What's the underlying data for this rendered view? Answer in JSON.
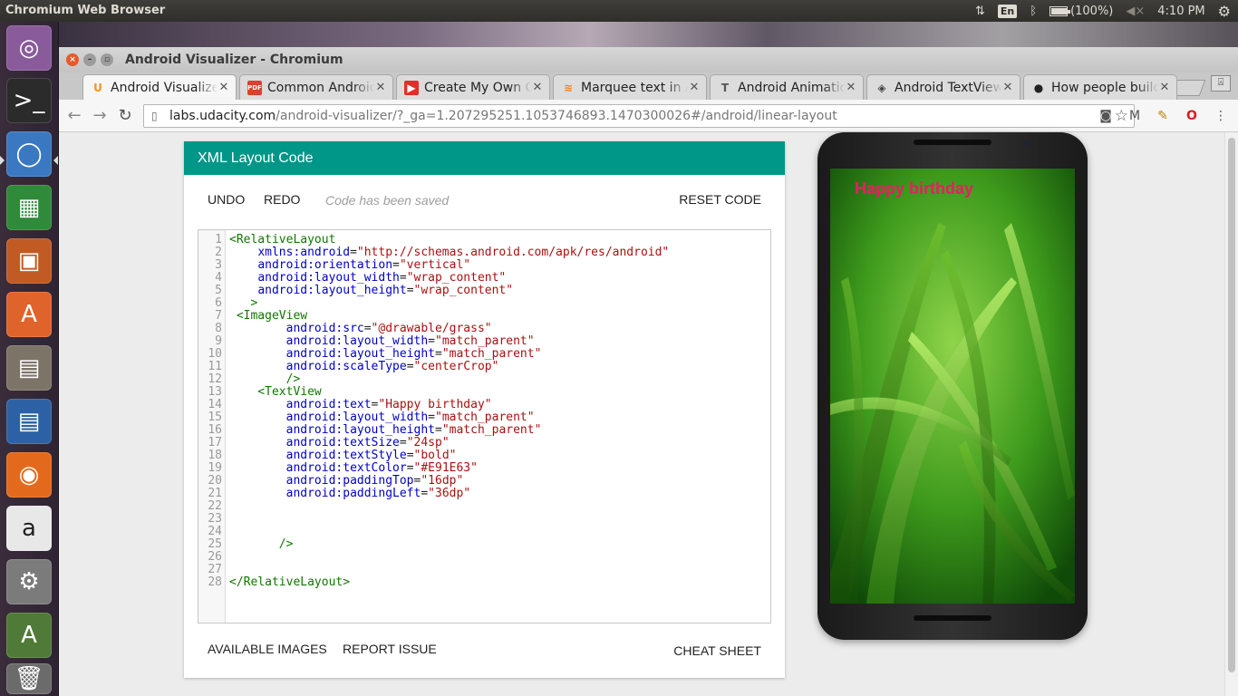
{
  "os": {
    "app_title": "Chromium Web Browser",
    "keyboard_layout": "En",
    "battery_text": "(100%)",
    "battery_level": 1.0,
    "clock": "4:10 PM"
  },
  "launcher": {
    "items": [
      {
        "name": "ubuntu-dash-icon",
        "color": "#8a5b9a",
        "glyph": "◎"
      },
      {
        "name": "terminal-icon",
        "color": "#2b2b2b",
        "glyph": ">_"
      },
      {
        "name": "chromium-icon",
        "color": "#3b78c2",
        "glyph": "◯"
      },
      {
        "name": "libreoffice-calc-icon",
        "color": "#2f8a3a",
        "glyph": "▦"
      },
      {
        "name": "libreoffice-impress-icon",
        "color": "#c25a23",
        "glyph": "▣"
      },
      {
        "name": "software-center-icon",
        "color": "#e0632b",
        "glyph": "A"
      },
      {
        "name": "files-icon",
        "color": "#7d7468",
        "glyph": "▤"
      },
      {
        "name": "libreoffice-writer-icon",
        "color": "#2c62a5",
        "glyph": "▤"
      },
      {
        "name": "firefox-icon",
        "color": "#e36a1c",
        "glyph": "◉"
      },
      {
        "name": "amazon-icon",
        "color": "#e8e8e8",
        "glyph": "a"
      },
      {
        "name": "system-settings-icon",
        "color": "#7b7b7b",
        "glyph": "⚙"
      },
      {
        "name": "software-updater-icon",
        "color": "#4f7a37",
        "glyph": "A"
      },
      {
        "name": "trash-icon",
        "color": "#6b6b6b",
        "glyph": "🗑"
      }
    ]
  },
  "window": {
    "title": "Android Visualizer - Chromium"
  },
  "tabs": [
    {
      "label": "Android Visualizer",
      "favicon": "U",
      "favicon_color": "#f7931e",
      "favicon_bg": "transparent",
      "active": true
    },
    {
      "label": "Common Android",
      "favicon": "PDF",
      "favicon_color": "#ffffff",
      "favicon_bg": "#d9422b",
      "active": false
    },
    {
      "label": "Create My Own Cust",
      "favicon": "▶",
      "favicon_color": "#ffffff",
      "favicon_bg": "#e52d27",
      "active": false
    },
    {
      "label": "Marquee text in And",
      "favicon": "≋",
      "favicon_color": "#f48024",
      "favicon_bg": "transparent",
      "active": false
    },
    {
      "label": "Android Animations",
      "favicon": "T",
      "favicon_color": "#555555",
      "favicon_bg": "transparent",
      "active": false
    },
    {
      "label": "Android TextView",
      "favicon": "◈",
      "favicon_color": "#444444",
      "favicon_bg": "transparent",
      "active": false
    },
    {
      "label": "How people build s",
      "favicon": "●",
      "favicon_color": "#222222",
      "favicon_bg": "transparent",
      "active": false
    }
  ],
  "toolbar": {
    "url_host": "labs.udacity.com",
    "url_path": "/android-visualizer/?_ga=1.207295251.1053746893.1470300026#/android/linear-layout"
  },
  "card": {
    "header": "XML Layout Code",
    "undo": "UNDO",
    "redo": "REDO",
    "saved_msg": "Code has been saved",
    "reset": "RESET CODE",
    "available_images": "AVAILABLE IMAGES",
    "report_issue": "REPORT ISSUE",
    "cheat_sheet": "CHEAT SHEET"
  },
  "code_lines": [
    {
      "n": "1",
      "parts": [
        [
          "t-tag",
          "<RelativeLayout"
        ]
      ]
    },
    {
      "n": "2",
      "parts": [
        [
          "t-punct",
          "    "
        ],
        [
          "t-attr",
          "xmlns:android"
        ],
        [
          "t-punct",
          "="
        ],
        [
          "t-str",
          "\"http://schemas.android.com/apk/res/android\""
        ]
      ]
    },
    {
      "n": "3",
      "parts": [
        [
          "t-punct",
          "    "
        ],
        [
          "t-attr",
          "android:orientation"
        ],
        [
          "t-punct",
          "="
        ],
        [
          "t-str",
          "\"vertical\""
        ]
      ]
    },
    {
      "n": "4",
      "parts": [
        [
          "t-punct",
          "    "
        ],
        [
          "t-attr",
          "android:layout_width"
        ],
        [
          "t-punct",
          "="
        ],
        [
          "t-str",
          "\"wrap_content\""
        ]
      ]
    },
    {
      "n": "5",
      "parts": [
        [
          "t-punct",
          "    "
        ],
        [
          "t-attr",
          "android:layout_height"
        ],
        [
          "t-punct",
          "="
        ],
        [
          "t-str",
          "\"wrap_content\""
        ]
      ]
    },
    {
      "n": "6",
      "parts": [
        [
          "t-tag",
          "   >"
        ]
      ]
    },
    {
      "n": "7",
      "parts": [
        [
          "t-tag",
          " <ImageView"
        ]
      ]
    },
    {
      "n": "8",
      "parts": [
        [
          "t-punct",
          "        "
        ],
        [
          "t-attr",
          "android:src"
        ],
        [
          "t-punct",
          "="
        ],
        [
          "t-str",
          "\"@drawable/grass\""
        ]
      ]
    },
    {
      "n": "9",
      "parts": [
        [
          "t-punct",
          "        "
        ],
        [
          "t-attr",
          "android:layout_width"
        ],
        [
          "t-punct",
          "="
        ],
        [
          "t-str",
          "\"match_parent\""
        ]
      ]
    },
    {
      "n": "10",
      "parts": [
        [
          "t-punct",
          "        "
        ],
        [
          "t-attr",
          "android:layout_height"
        ],
        [
          "t-punct",
          "="
        ],
        [
          "t-str",
          "\"match_parent\""
        ]
      ]
    },
    {
      "n": "11",
      "parts": [
        [
          "t-punct",
          "        "
        ],
        [
          "t-attr",
          "android:scaleType"
        ],
        [
          "t-punct",
          "="
        ],
        [
          "t-str",
          "\"centerCrop\""
        ]
      ]
    },
    {
      "n": "12",
      "parts": [
        [
          "t-tag",
          "        />"
        ]
      ]
    },
    {
      "n": "13",
      "parts": [
        [
          "t-tag",
          "    <TextView"
        ]
      ]
    },
    {
      "n": "14",
      "parts": [
        [
          "t-punct",
          "        "
        ],
        [
          "t-attr",
          "android:text"
        ],
        [
          "t-punct",
          "="
        ],
        [
          "t-str",
          "\"Happy birthday\""
        ]
      ]
    },
    {
      "n": "15",
      "parts": [
        [
          "t-punct",
          "        "
        ],
        [
          "t-attr",
          "android:layout_width"
        ],
        [
          "t-punct",
          "="
        ],
        [
          "t-str",
          "\"match_parent\""
        ]
      ]
    },
    {
      "n": "16",
      "parts": [
        [
          "t-punct",
          "        "
        ],
        [
          "t-attr",
          "android:layout_height"
        ],
        [
          "t-punct",
          "="
        ],
        [
          "t-str",
          "\"match_parent\""
        ]
      ]
    },
    {
      "n": "17",
      "parts": [
        [
          "t-punct",
          "        "
        ],
        [
          "t-attr",
          "android:textSize"
        ],
        [
          "t-punct",
          "="
        ],
        [
          "t-str",
          "\"24sp\""
        ]
      ]
    },
    {
      "n": "18",
      "parts": [
        [
          "t-punct",
          "        "
        ],
        [
          "t-attr",
          "android:textStyle"
        ],
        [
          "t-punct",
          "="
        ],
        [
          "t-str",
          "\"bold\""
        ]
      ]
    },
    {
      "n": "19",
      "parts": [
        [
          "t-punct",
          "        "
        ],
        [
          "t-attr",
          "android:textColor"
        ],
        [
          "t-punct",
          "="
        ],
        [
          "t-str",
          "\"#E91E63\""
        ]
      ]
    },
    {
      "n": "20",
      "parts": [
        [
          "t-punct",
          "        "
        ],
        [
          "t-attr",
          "android:paddingTop"
        ],
        [
          "t-punct",
          "="
        ],
        [
          "t-str",
          "\"16dp\""
        ]
      ]
    },
    {
      "n": "21",
      "parts": [
        [
          "t-punct",
          "        "
        ],
        [
          "t-attr",
          "android:paddingLeft"
        ],
        [
          "t-punct",
          "="
        ],
        [
          "t-str",
          "\"36dp\""
        ]
      ]
    },
    {
      "n": "22",
      "parts": []
    },
    {
      "n": "23",
      "parts": []
    },
    {
      "n": "24",
      "parts": []
    },
    {
      "n": "25",
      "parts": [
        [
          "t-tag",
          "       />"
        ]
      ]
    },
    {
      "n": "26",
      "parts": []
    },
    {
      "n": "27",
      "parts": []
    },
    {
      "n": "28",
      "parts": [
        [
          "t-tag",
          "</RelativeLayout>"
        ]
      ]
    }
  ],
  "preview": {
    "text": "Happy birthday",
    "text_color": "#E91E63"
  }
}
